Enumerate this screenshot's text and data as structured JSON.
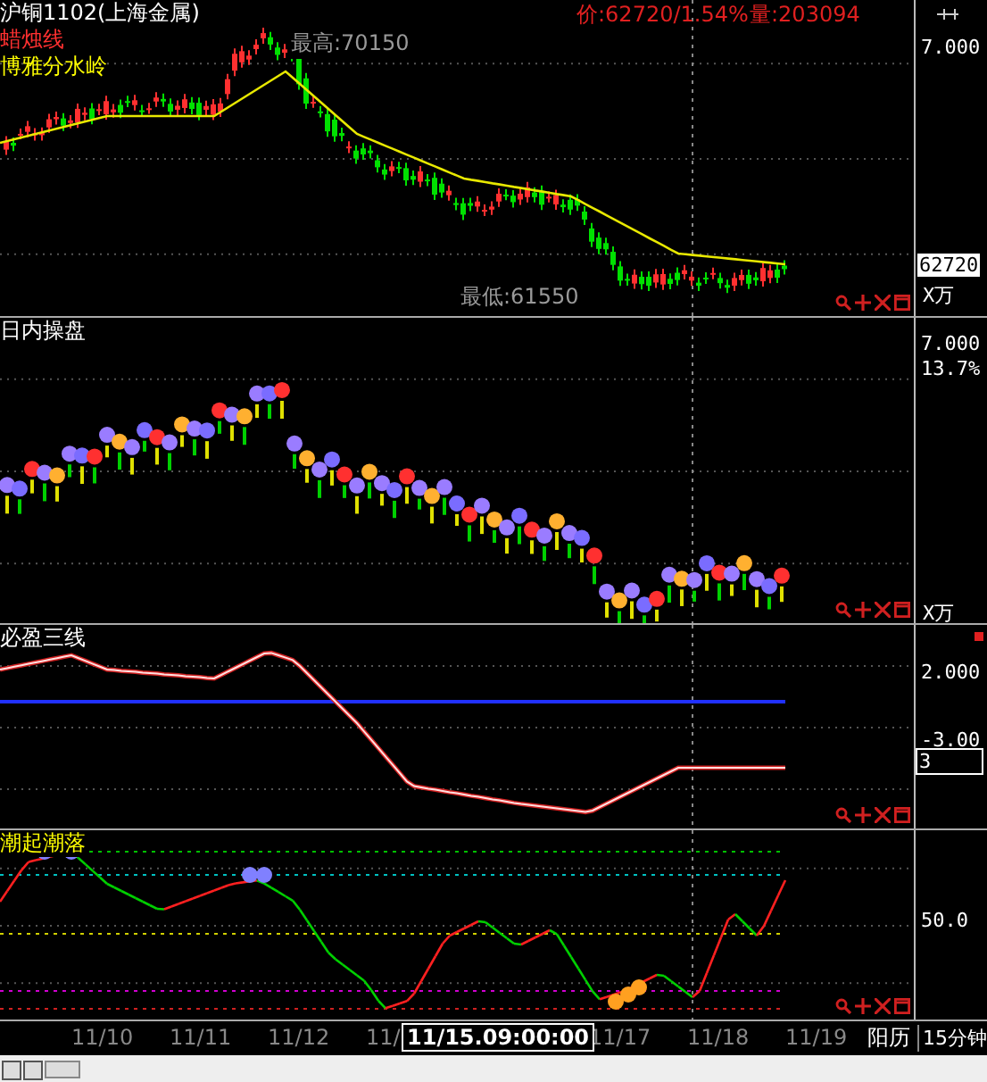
{
  "instrument": {
    "title": "沪铜1102(上海金属)",
    "quote": "价:62720/1.54%",
    "volume": "量:203094"
  },
  "panels": [
    {
      "kind": "price",
      "legends": [
        {
          "label": "蜡烛线",
          "color": "#ff3030"
        },
        {
          "label": "博雅分水岭",
          "color": "#ffff00"
        }
      ],
      "high": "最高:70150",
      "low": "最低:61550",
      "axis_labels": [
        "7.000"
      ],
      "price_tag": "62720",
      "unit": "X万"
    },
    {
      "kind": "balls",
      "title": "日内操盘",
      "axis_labels": [
        "7.000",
        "13.7%"
      ],
      "unit": "X万"
    },
    {
      "kind": "lines",
      "title": "必盈三线",
      "axis_labels": [
        "2.000",
        "-3.00"
      ],
      "value_tag": "3"
    },
    {
      "kind": "oscillator",
      "title": "潮起潮落",
      "axis_labels": [
        "50.0"
      ]
    }
  ],
  "time_axis": {
    "dates": [
      "11/10",
      "11/11",
      "11/12",
      "11/",
      "11/17",
      "11/18",
      "11/19"
    ],
    "cursor": "11/15.09:00:00",
    "calendar": "阳历",
    "period": "15分钟"
  }
}
